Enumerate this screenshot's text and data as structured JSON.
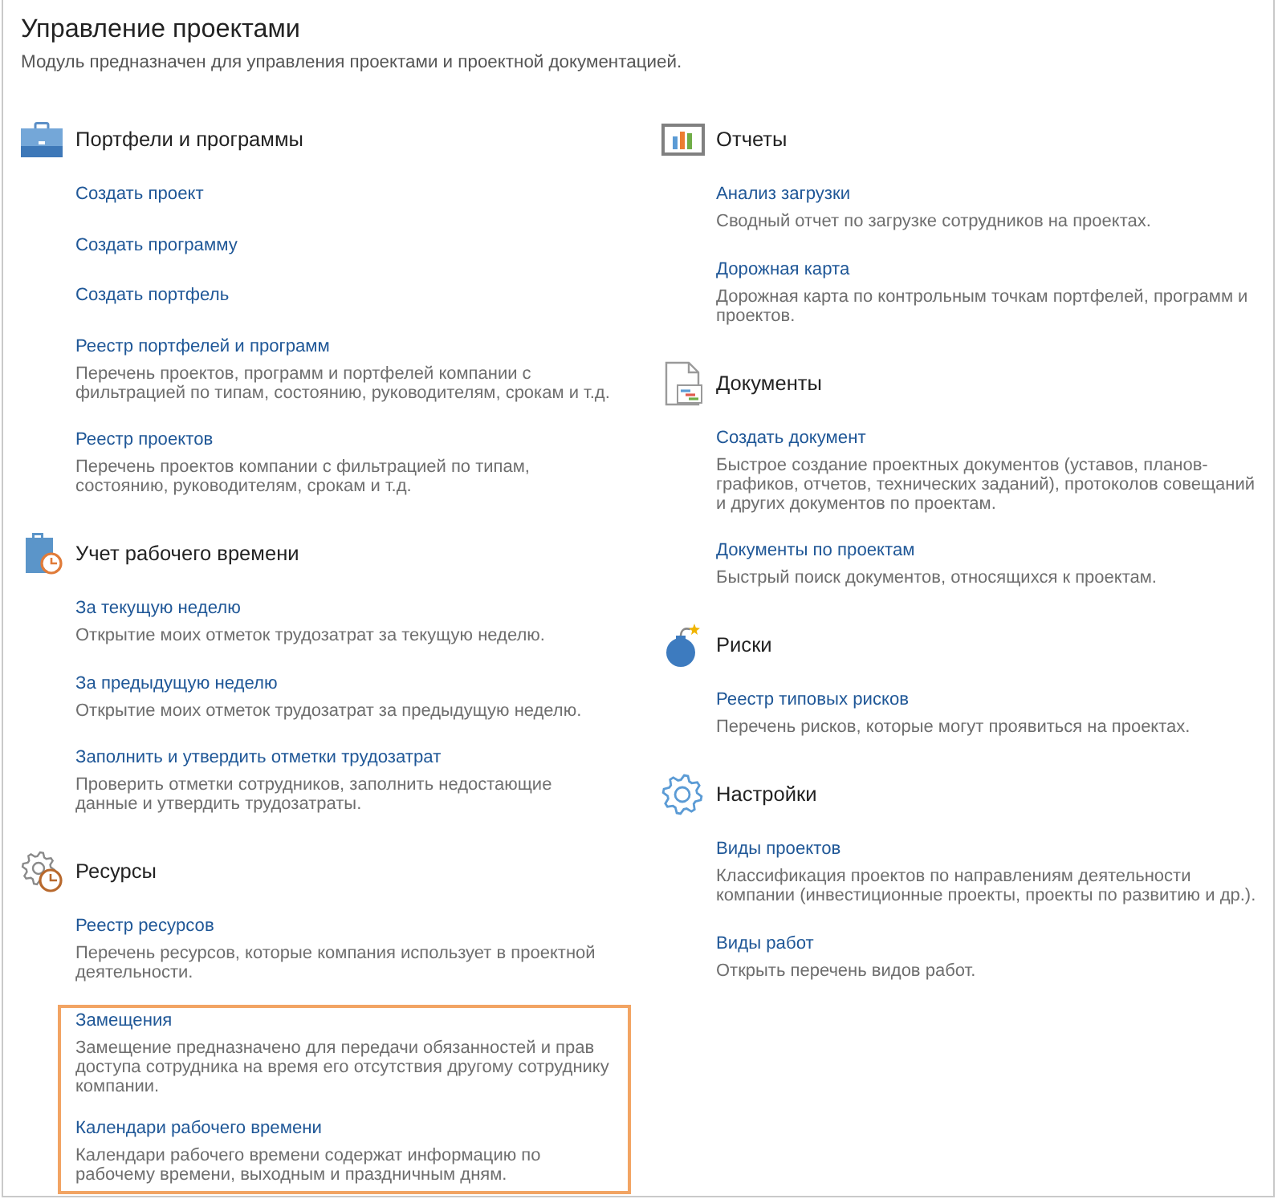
{
  "page": {
    "title": "Управление проектами",
    "subtitle": "Модуль предназначен для управления проектами и проектной документацией."
  },
  "columns": [
    {
      "sections": [
        {
          "kind": "portfolios",
          "title": "Портфели и программы",
          "items": [
            {
              "link": "Создать проект"
            },
            {
              "link": "Создать программу"
            },
            {
              "link": "Создать портфель"
            },
            {
              "link": "Реестр портфелей и программ",
              "description": "Перечень проектов, программ и портфелей компании с фильтрацией по типам, состоянию, руководителям, срокам и т.д."
            },
            {
              "link": "Реестр проектов",
              "description": "Перечень проектов компании с фильтрацией по типам, состоянию, руководителям, срокам и т.д."
            }
          ]
        },
        {
          "kind": "timesheets",
          "title": "Учет рабочего времени",
          "items": [
            {
              "link": "За текущую неделю",
              "description": "Открытие моих отметок трудозатрат за текущую неделю."
            },
            {
              "link": "За предыдущую неделю",
              "description": "Открытие моих отметок трудозатрат за предыдущую неделю."
            },
            {
              "link": "Заполнить и утвердить отметки трудозатрат",
              "description": "Проверить отметки сотрудников, заполнить недостающие данные и утвердить трудозатраты."
            }
          ]
        },
        {
          "kind": "resources",
          "title": "Ресурсы",
          "items": [
            {
              "link": "Реестр ресурсов",
              "description": "Перечень ресурсов, которые компания использует в проектной деятельности.",
              "highlighted": false
            },
            {
              "link": "Замещения",
              "description": "Замещение предназначено для передачи обязанностей и прав доступа сотрудника на время его отсутствия другому сотруднику компании.",
              "highlighted": true
            },
            {
              "link": "Календари рабочего времени",
              "description": "Календари рабочего времени содержат информацию по рабочему времени, выходным и праздничным дням.",
              "highlighted": true
            }
          ]
        }
      ]
    },
    {
      "sections": [
        {
          "kind": "reports",
          "title": "Отчеты",
          "items": [
            {
              "link": "Анализ загрузки",
              "description": "Сводный отчет по загрузке сотрудников на проектах."
            },
            {
              "link": "Дорожная карта",
              "description": "Дорожная карта по контрольным точкам портфелей, программ и проектов."
            }
          ]
        },
        {
          "kind": "documents",
          "title": "Документы",
          "items": [
            {
              "link": "Создать документ",
              "description": "Быстрое создание проектных документов (уставов, планов-графиков, отчетов, технических заданий), протоколов совещаний и других документов по проектам."
            },
            {
              "link": "Документы по проектам",
              "description": "Быстрый поиск документов, относящихся к проектам."
            }
          ]
        },
        {
          "kind": "risks",
          "title": "Риски",
          "items": [
            {
              "link": "Реестр типовых рисков",
              "description": "Перечень рисков, которые могут проявиться на проектах."
            }
          ]
        },
        {
          "kind": "settings",
          "title": "Настройки",
          "items": [
            {
              "link": "Виды проектов",
              "description": "Классификация проектов по направлениям деятельности компании (инвестиционные проекты, проекты по развитию и др.)."
            },
            {
              "link": "Виды работ",
              "description": "Открыть перечень видов работ."
            }
          ]
        }
      ]
    }
  ]
}
